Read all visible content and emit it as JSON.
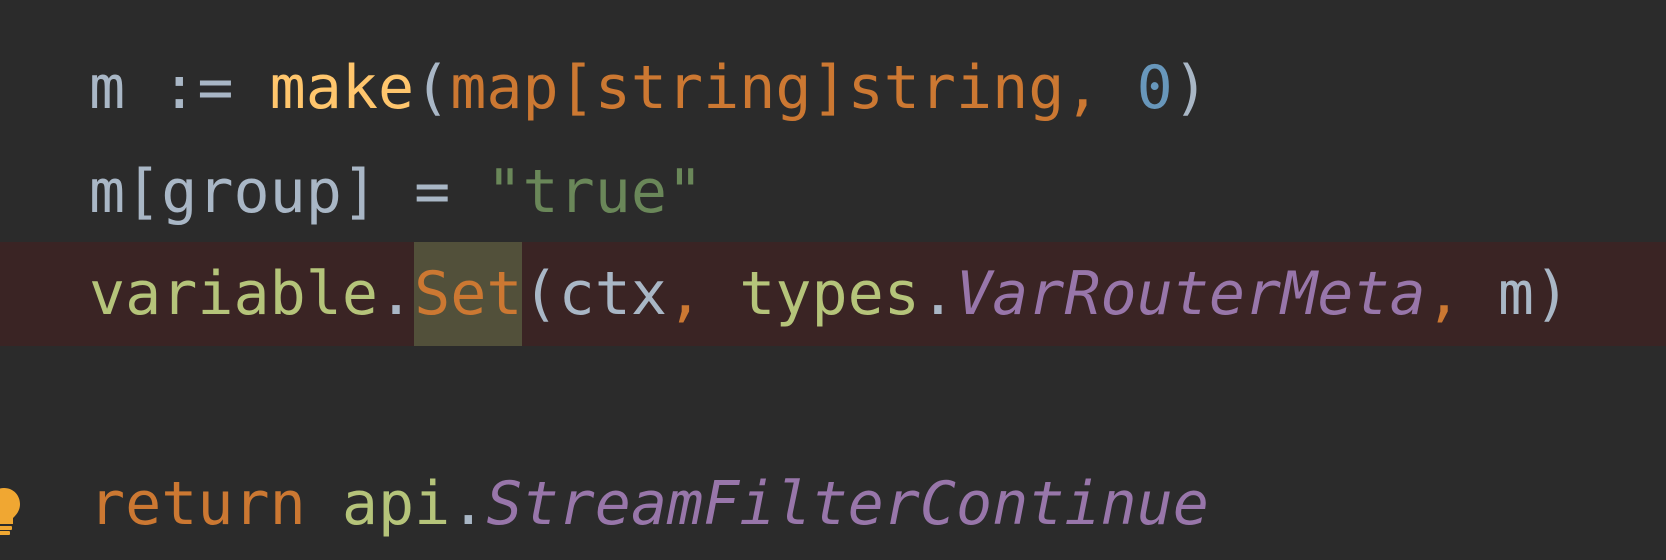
{
  "editor": {
    "line1": {
      "var": "m",
      "assign": ":=",
      "func": "make",
      "open": "(",
      "type": "map[string]string",
      "comma": ",",
      "num": "0",
      "close": ")"
    },
    "line2": {
      "var": "m[group]",
      "eq": "=",
      "str": "\"true\""
    },
    "line3": {
      "pkg": "variable",
      "dot": ".",
      "method": "Set",
      "open": "(ctx",
      "comma1": ",",
      "pkg2": "types",
      "dot2": ".",
      "const": "VarRouterMeta",
      "comma2": ",",
      "arg": "m)"
    },
    "line5": {
      "kw": "return",
      "pkg": "api",
      "dot": ".",
      "const": "StreamFilterContinue"
    }
  },
  "colors": {
    "background": "#2b2b2b",
    "highlight_line": "#3a2424",
    "keyword": "#cc7832",
    "function": "#ffc66d",
    "string": "#6a8759",
    "number": "#6897bb",
    "constant": "#9876aa"
  },
  "icons": {
    "gutter": "lightbulb-icon"
  }
}
